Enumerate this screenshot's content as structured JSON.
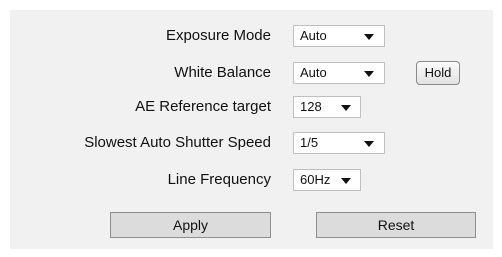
{
  "settings": {
    "exposure_mode": {
      "label": "Exposure Mode",
      "value": "Auto"
    },
    "white_balance": {
      "label": "White Balance",
      "value": "Auto"
    },
    "ae_reference": {
      "label": "AE Reference target",
      "value": "128"
    },
    "slowest_shutter": {
      "label": "Slowest Auto Shutter Speed",
      "value": "1/5"
    },
    "line_frequency": {
      "label": "Line Frequency",
      "value": "60Hz"
    }
  },
  "buttons": {
    "hold": "Hold",
    "apply": "Apply",
    "reset": "Reset"
  },
  "icons": {
    "dropdown": "chevron-down-icon"
  },
  "colors": {
    "panel_background": "#f1f1f1",
    "field_background": "#ffffff",
    "button_face": "#dcdcdc"
  }
}
